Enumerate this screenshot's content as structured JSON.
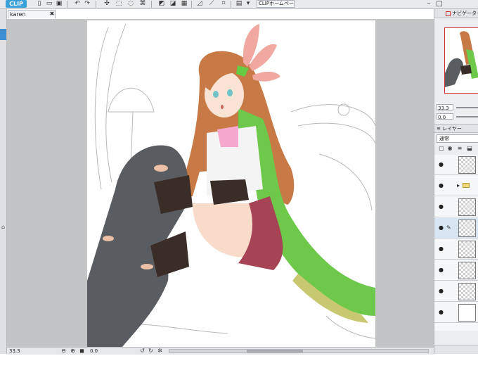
{
  "app": {
    "logo": "CLIP",
    "home_button": "CLIPホームページ",
    "document_tab": "karen",
    "document_tab_close": "✖"
  },
  "toolbar": {
    "icons": [
      "new-file-icon",
      "open-file-icon",
      "save-icon",
      "undo-icon",
      "redo-icon",
      "sparkle-icon",
      "transform-icon",
      "lasso-icon",
      "mesh-icon",
      "ruler-icon",
      "perspective-icon",
      "symmetry-icon",
      "grid-icon",
      "snap-dropdown-icon"
    ]
  },
  "navigator": {
    "title": "ナビゲーター",
    "zoom_value": "33.3",
    "rotation_value": "0.0"
  },
  "layers_panel": {
    "title": "レイヤー",
    "blend_mode": "通常",
    "layers": [
      {
        "type": "layer",
        "visible": true,
        "selected": false,
        "thumb": "transparent"
      },
      {
        "type": "folder",
        "visible": true,
        "selected": false,
        "thumb": "folder"
      },
      {
        "type": "layer",
        "visible": true,
        "selected": false,
        "thumb": "transparent"
      },
      {
        "type": "layer",
        "visible": true,
        "selected": true,
        "thumb": "transparent"
      },
      {
        "type": "layer",
        "visible": true,
        "selected": false,
        "thumb": "transparent"
      },
      {
        "type": "layer",
        "visible": true,
        "selected": false,
        "thumb": "transparent"
      },
      {
        "type": "layer",
        "visible": true,
        "selected": false,
        "thumb": "transparent"
      },
      {
        "type": "paper",
        "visible": true,
        "selected": false,
        "thumb": "white"
      }
    ]
  },
  "status_bar": {
    "zoom": "33.3",
    "rotation": "0.0"
  },
  "colors": {
    "toolbar_bg": "#e9eaec",
    "canvas_bg": "#c3c4c6",
    "accent_blue": "#3d8fd1",
    "navigator_frame": "#d0302c",
    "skin": "#f8dbc9",
    "hair": "#c77a46",
    "coat_green": "#6ec84a",
    "skirt_red": "#a64455",
    "stockings": "#595c60",
    "gloves": "#3a2d27",
    "feather_pink": "#f0a8a0"
  }
}
